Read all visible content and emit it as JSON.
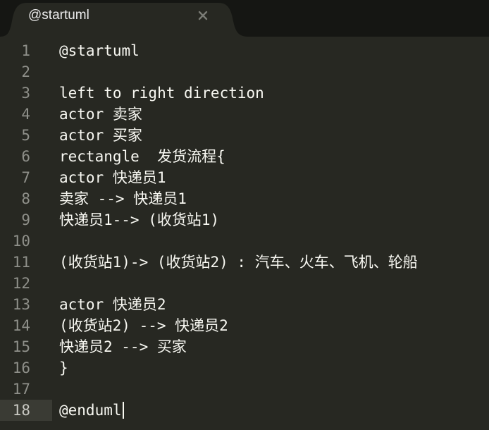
{
  "tab": {
    "title": "@startuml",
    "close_icon": "close-icon"
  },
  "editor": {
    "lines": [
      {
        "num": "1",
        "text": "@startuml"
      },
      {
        "num": "2",
        "text": ""
      },
      {
        "num": "3",
        "text": "left to right direction"
      },
      {
        "num": "4",
        "text": "actor 卖家"
      },
      {
        "num": "5",
        "text": "actor 买家"
      },
      {
        "num": "6",
        "text": "rectangle  发货流程{"
      },
      {
        "num": "7",
        "text": "actor 快递员1"
      },
      {
        "num": "8",
        "text": "卖家 --> 快递员1"
      },
      {
        "num": "9",
        "text": "快递员1--> (收货站1)"
      },
      {
        "num": "10",
        "text": ""
      },
      {
        "num": "11",
        "text": "(收货站1)-> (收货站2) : 汽车、火车、飞机、轮船"
      },
      {
        "num": "12",
        "text": ""
      },
      {
        "num": "13",
        "text": "actor 快递员2"
      },
      {
        "num": "14",
        "text": "(收货站2) --> 快递员2"
      },
      {
        "num": "15",
        "text": "快递员2 --> 买家"
      },
      {
        "num": "16",
        "text": "}"
      },
      {
        "num": "17",
        "text": ""
      },
      {
        "num": "18",
        "text": "@enduml"
      }
    ],
    "active_line": 18
  },
  "colors": {
    "background": "#272822",
    "tabbar": "#151613",
    "tab_active": "#272822",
    "text": "#f8f8f2",
    "line_number": "#8f908a"
  }
}
